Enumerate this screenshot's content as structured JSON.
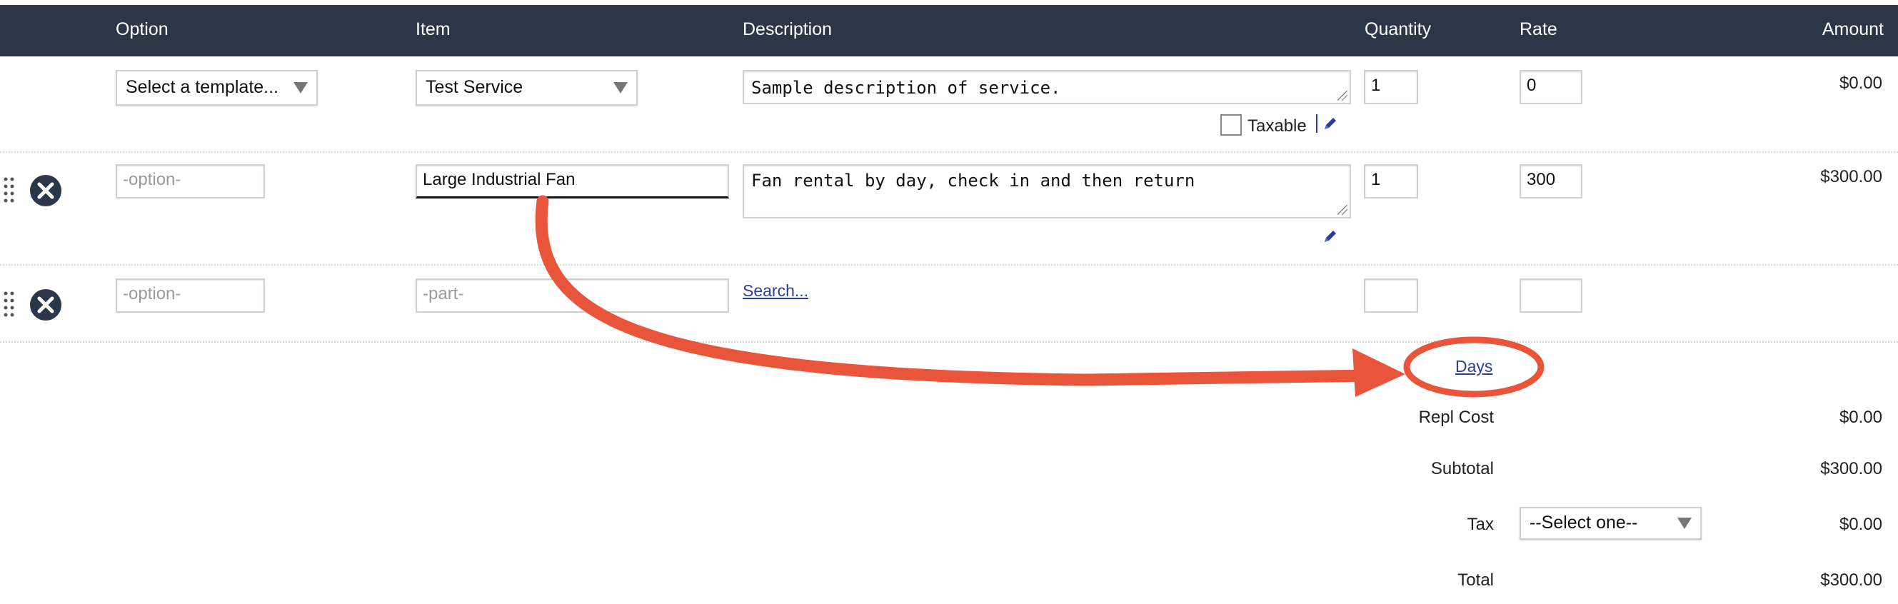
{
  "header": {
    "option": "Option",
    "item": "Item",
    "description": "Description",
    "quantity": "Quantity",
    "rate": "Rate",
    "amount": "Amount"
  },
  "rows": [
    {
      "option_select": "Select a template...",
      "item_select": "Test Service",
      "description": "Sample description of service.",
      "taxable_label": "Taxable",
      "taxable_checked": false,
      "quantity": "1",
      "rate": "0",
      "amount": "$0.00"
    },
    {
      "option_placeholder": "-option-",
      "item": "Large Industrial Fan",
      "description": "Fan rental by day, check in and then return",
      "quantity": "1",
      "rate": "300",
      "amount": "$300.00"
    },
    {
      "option_placeholder": "-option-",
      "item_placeholder": "-part-",
      "search_link": "Search...",
      "quantity": "",
      "rate": ""
    }
  ],
  "days_link": "Days",
  "summary": {
    "repl_cost_label": "Repl Cost",
    "repl_cost_value": "$0.00",
    "subtotal_label": "Subtotal",
    "subtotal_value": "$300.00",
    "tax_label": "Tax",
    "tax_select": "--Select one--",
    "tax_value": "$0.00",
    "total_label": "Total",
    "total_value": "$300.00"
  },
  "colors": {
    "header_bg": "#2b3748",
    "annotation": "#e8553a",
    "link": "#2a3f9a"
  },
  "icons": [
    "drag-handle-icon",
    "remove-circle-x-icon",
    "pencil-edit-icon",
    "dropdown-caret-icon"
  ]
}
